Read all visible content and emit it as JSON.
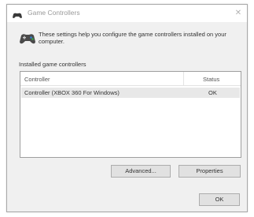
{
  "window": {
    "title": "Game Controllers",
    "close_glyph": "✕"
  },
  "info": {
    "text": "These settings help you configure the game controllers installed on your computer."
  },
  "controllers": {
    "group_label": "Installed game controllers",
    "columns": {
      "controller": "Controller",
      "status": "Status"
    },
    "rows": [
      {
        "controller": "Controller (XBOX 360 For Windows)",
        "status": "OK"
      }
    ]
  },
  "buttons": {
    "advanced": "Advanced...",
    "properties": "Properties",
    "ok": "OK"
  },
  "icons": {
    "title": "gamepad-icon",
    "info": "gamepad-icon"
  }
}
